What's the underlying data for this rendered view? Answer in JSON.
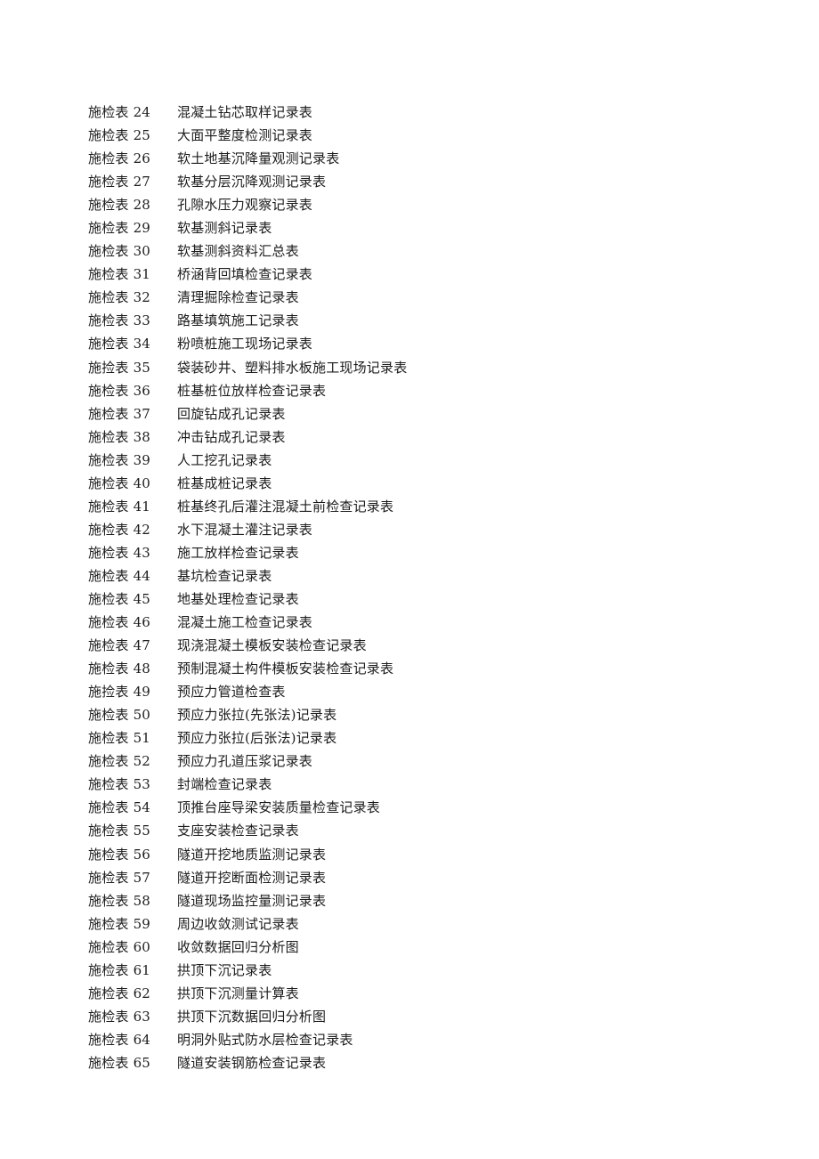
{
  "document": {
    "background_color": "#ffffff",
    "text_color": "#1c1c1c",
    "entries": [
      {
        "code": "施检表 24",
        "title": "混凝土钻芯取样记录表"
      },
      {
        "code": "施检表 25",
        "title": "大面平整度检测记录表"
      },
      {
        "code": "施检表 26",
        "title": "软土地基沉降量观测记录表"
      },
      {
        "code": "施检表 27",
        "title": "软基分层沉降观测记录表"
      },
      {
        "code": "施检表 28",
        "title": "孔隙水压力观察记录表"
      },
      {
        "code": "施检表 29",
        "title": "软基测斜记录表"
      },
      {
        "code": "施检表 30",
        "title": "软基测斜资料汇总表"
      },
      {
        "code": "施检表 31",
        "title": "桥涵背回填检查记录表"
      },
      {
        "code": "施检表 32",
        "title": "清理掘除检查记录表"
      },
      {
        "code": "施检表 33",
        "title": "路基填筑施工记录表"
      },
      {
        "code": "施检表 34",
        "title": "粉喷桩施工现场记录表"
      },
      {
        "code": "施捡表 35",
        "title": "袋装砂井、塑料排水板施工现场记录表"
      },
      {
        "code": "施检表 36",
        "title": "桩基桩位放样检查记录表"
      },
      {
        "code": "施检表 37",
        "title": "回旋钻成孔记录表"
      },
      {
        "code": "施检表 38",
        "title": "冲击钻成孔记录表"
      },
      {
        "code": "施检表 39",
        "title": "人工挖孔记录表"
      },
      {
        "code": "施检表 40",
        "title": "桩基成桩记录表"
      },
      {
        "code": "施检表 41",
        "title": "桩基终孔后灌注混凝土前检查记录表"
      },
      {
        "code": "施检表 42",
        "title": "水下混凝土灌注记录表"
      },
      {
        "code": "施检表 43",
        "title": "施工放样检查记录表"
      },
      {
        "code": "施检表 44",
        "title": "基坑检查记录表"
      },
      {
        "code": "施检表 45",
        "title": "地基处理检查记录表"
      },
      {
        "code": "施检表 46",
        "title": "混凝土施工检查记录表"
      },
      {
        "code": "施检表 47",
        "title": "现浇混凝土模板安装检查记录表"
      },
      {
        "code": "施检表 48",
        "title": "预制混凝土构件模板安装检查记录表"
      },
      {
        "code": "施捡表 49",
        "title": "预应力管道检查表"
      },
      {
        "code": "施检表 50",
        "title": "预应力张拉(先张法)记录表"
      },
      {
        "code": "施检表 51",
        "title": "预应力张拉(后张法)记录表"
      },
      {
        "code": "施检表 52",
        "title": "预应力孔道压浆记录表"
      },
      {
        "code": "施检表 53",
        "title": "封端检查记录表"
      },
      {
        "code": "施检表 54",
        "title": "顶推台座导梁安装质量检查记录表"
      },
      {
        "code": "施检表 55",
        "title": "支座安装检查记录表"
      },
      {
        "code": "施检表 56",
        "title": "隧道开挖地质监测记录表"
      },
      {
        "code": "施检表 57",
        "title": "隧道开挖断面检测记录表"
      },
      {
        "code": "施检表 58",
        "title": "隧道现场监控量测记录表"
      },
      {
        "code": "施检表 59",
        "title": "周边收敛测试记录表"
      },
      {
        "code": "施检表 60",
        "title": "收敛数据回归分析图"
      },
      {
        "code": "施检表 61",
        "title": "拱顶下沉记录表"
      },
      {
        "code": "施检表 62",
        "title": "拱顶下沉测量计算表"
      },
      {
        "code": "施检表 63",
        "title": "拱顶下沉数据回归分析图"
      },
      {
        "code": "施检表 64",
        "title": "明洞外贴式防水层检查记录表"
      },
      {
        "code": "施检表 65",
        "title": "隧道安装钢筋检查记录表"
      }
    ]
  }
}
